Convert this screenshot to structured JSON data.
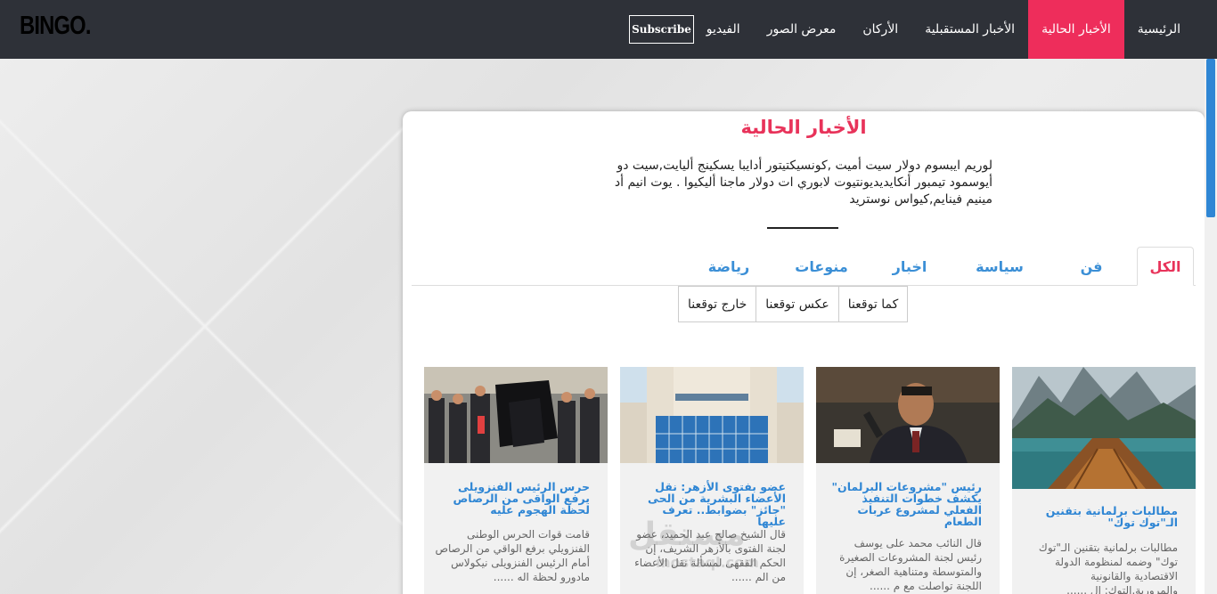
{
  "header": {
    "logo": "BINGO",
    "logo_dot": ".",
    "subscribe_label": "Subscribe",
    "nav": [
      {
        "label": "الرئيسية"
      },
      {
        "label": "الأخبار الحالية",
        "active": true
      },
      {
        "label": "الأخبار المستقبلية"
      },
      {
        "label": "الأركان"
      },
      {
        "label": "معرض الصور"
      },
      {
        "label": "الفيديو"
      }
    ],
    "accent_color": "#ee2d5b"
  },
  "section": {
    "title": "الأخبار الحالية",
    "intro": "لوريم ايبسوم دولار سيت أميت ,كونسيكتيتور أدايبا يسكينج أليايت,سيت دو أيوسمود تيمبور أنكايديديونتيوت لابوري ات دولار ماجنا أليكيوا . يوت انيم أد مينيم فينايم,كيواس نوستريد"
  },
  "tabs": [
    {
      "label": "الكل",
      "active": true
    },
    {
      "label": "فن"
    },
    {
      "label": "سياسة"
    },
    {
      "label": "اخبار"
    },
    {
      "label": "منوعات"
    },
    {
      "label": "رياضة"
    }
  ],
  "filters": [
    {
      "label": "كما توقعنا"
    },
    {
      "label": "عكس توقعنا"
    },
    {
      "label": "خارج توقعنا"
    }
  ],
  "news": [
    {
      "title": "مطالبات برلمانية بتقنين الـ\"توك توك\"",
      "body": "مطالبات برلمانية بتقنين الـ\"توك توك\" وضمه لمنظومة الدولة الاقتصادية والقانونية والمرورية.التوك: ال ......",
      "image": "mountain-lake-boat"
    },
    {
      "title": "رئيس \"مشروعات البرلمان\" يكشف خطوات التنفيذ الفعلي لمشروع عربات الطعام",
      "body": "قال النائب محمد على يوسف رئيس لجنة المشروعات الصغيرة والمتوسطة ومتناهية الصغر، إن اللجنة تواصلت مع م ......",
      "image": "parliament-speaker"
    },
    {
      "title": "عضو بفتوى الأزهر: نقل الأعضاء البشرية من الحى \"جائز\" بضوابط.. تعرف عليها",
      "body": "قال الشيخ صالح عبد الحميد، عضو لجنة الفتوى بالأزهر الشريف، إن الحكم الفقهى لمسألة نقل الأعضاء من الم ......",
      "image": "azhar-building"
    },
    {
      "title": "حرس الرئيس الفنزويلى يرفع الواقى من الرصاص لحظة الهجوم عليه",
      "body": "قامت قوات الحرس الوطنى الفنزويلي برفع الواقي من الرصاص أمام الرئيس الفنزويلى نيكولاس مادورو لحظة اله ......",
      "image": "venezuela-guards"
    }
  ],
  "watermark": {
    "text": "مستقل",
    "sub": "mostaql.com"
  }
}
